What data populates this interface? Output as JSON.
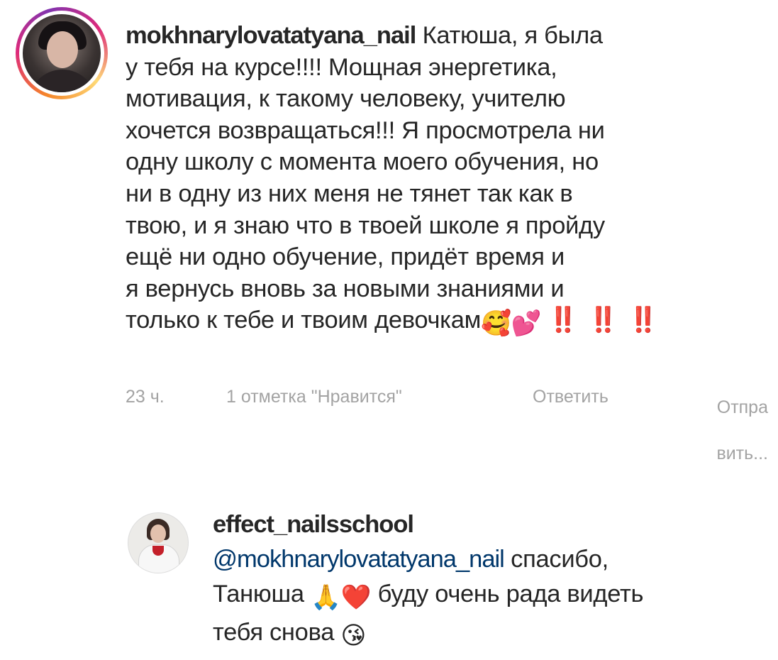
{
  "comment": {
    "username": "mokhnarylovatatyana_nail",
    "lines": [
      " Катюша, я была",
      "у тебя на курсе!!!! Мощная энергетика,",
      "мотивация, к такому человеку, учителю",
      "хочется возвращаться!!! Я просмотрела ни",
      "одну школу с момента моего обучения, но",
      "ни в одну из них меня не тянет так как в",
      "твою, и я знаю что в твоей школе я пройду",
      "ещё ни одно обучение, придёт время и",
      "я вернусь вновь за новыми знаниями и",
      "только к тебе и твоим девочкам"
    ],
    "trailing_emojis": [
      "🥰",
      "💕"
    ],
    "trailing_bangs": "‼️ ‼️ ‼️",
    "time": "23 ч.",
    "likes": "1 отметка \"Нравится\"",
    "reply_label": "Ответить",
    "send_label_line1": "Отпра",
    "send_label_line2": "вить..."
  },
  "reply": {
    "username": "effect_nailsschool",
    "mention": "@mokhnarylovatatyana_nail",
    "text_line1": " спасибо,",
    "text_line2_a": "Танюша ",
    "text_line2_emojis": [
      "🙏",
      "❤️"
    ],
    "text_line2_b": " буду очень рада видеть",
    "text_line3": "тебя снова ",
    "text_line3_emoji": "😘"
  },
  "colors": {
    "text": "#262626",
    "meta": "#a3a3a3",
    "mention": "#00376b",
    "exclamation": "#e0121f"
  }
}
